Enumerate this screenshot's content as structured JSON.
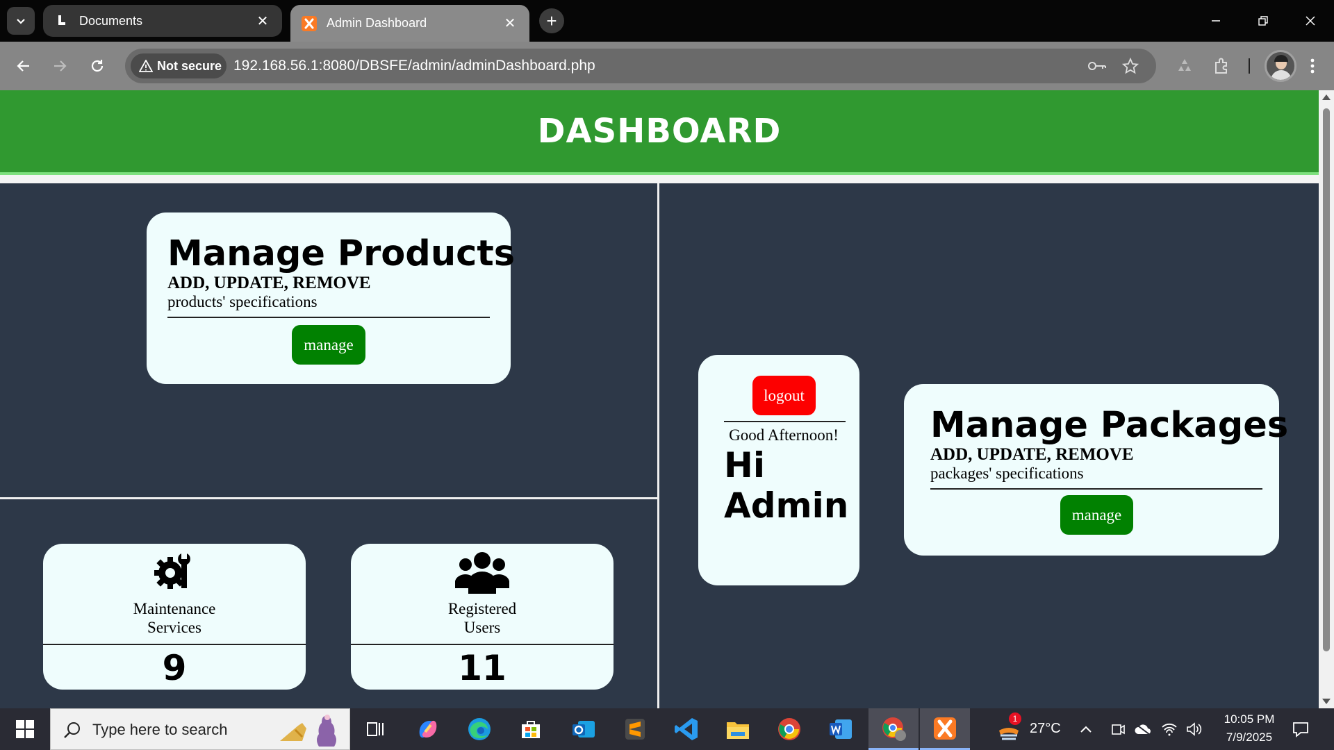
{
  "browser": {
    "tabs": [
      {
        "title": "Documents"
      },
      {
        "title": "Admin Dashboard"
      }
    ],
    "security_label": "Not secure",
    "url": "192.168.56.1:8080/DBSFE/admin/adminDashboard.php"
  },
  "page": {
    "header_title": "DASHBOARD",
    "products_card": {
      "title": "Manage Products",
      "actions": "ADD, UPDATE, REMOVE",
      "description": "products' specifications",
      "button": "manage"
    },
    "packages_card": {
      "title": "Manage Packages",
      "actions": "ADD, UPDATE, REMOVE",
      "description": "packages' specifications",
      "button": "manage"
    },
    "greeting_card": {
      "logout": "logout",
      "greeting": "Good Afternoon!",
      "hi": "Hi",
      "name": "Admin"
    },
    "maintenance_card": {
      "label_line1": "Maintenance",
      "label_line2": "Services",
      "count": "9",
      "icon": "gear-wrench-icon"
    },
    "users_card": {
      "label_line1": "Registered",
      "label_line2": "Users",
      "count": "11",
      "icon": "users-icon"
    }
  },
  "taskbar": {
    "search_placeholder": "Type here to search",
    "weather": "27°C",
    "weather_badge": "1",
    "time": "10:05 PM",
    "date": "7/9/2025"
  },
  "colors": {
    "header": "#309930",
    "page_bg": "#2d3848",
    "card_bg": "#effdfd",
    "manage_button": "#018101",
    "logout_button": "#fd0000"
  }
}
